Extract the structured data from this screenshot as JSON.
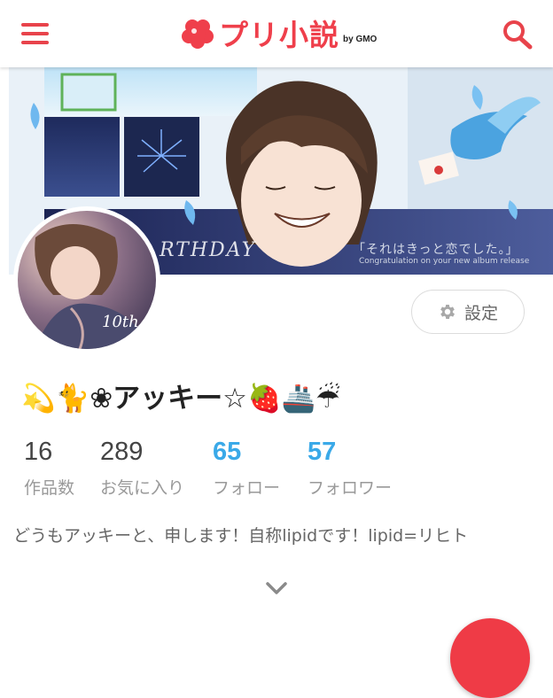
{
  "header": {
    "app_name": "プリ小説",
    "app_sub": "by GMO",
    "menu_icon": "hamburger-menu-icon",
    "search_icon": "search-icon",
    "brand_color": "#ef3f4b"
  },
  "cover": {
    "text_birthday": "RTHDAY",
    "text_song": "「それはきっと恋でした。」",
    "text_caption": "Congratulation on your new album release"
  },
  "avatar": {
    "overlay_text": "10th"
  },
  "settings": {
    "label": "設定",
    "icon": "gear-icon"
  },
  "profile": {
    "username": "💫🐈❀アッキー☆🍓🚢☔",
    "bio": "どうもアッキーと、申します！自称lipidです！lipid=リヒト"
  },
  "stats": [
    {
      "value": "16",
      "label": "作品数",
      "highlight": false
    },
    {
      "value": "289",
      "label": "お気に入り",
      "highlight": false
    },
    {
      "value": "65",
      "label": "フォロー",
      "highlight": true
    },
    {
      "value": "57",
      "label": "フォロワー",
      "highlight": true
    }
  ],
  "colors": {
    "accent_red": "#ef3b46",
    "link_blue": "#3aa9e8"
  }
}
